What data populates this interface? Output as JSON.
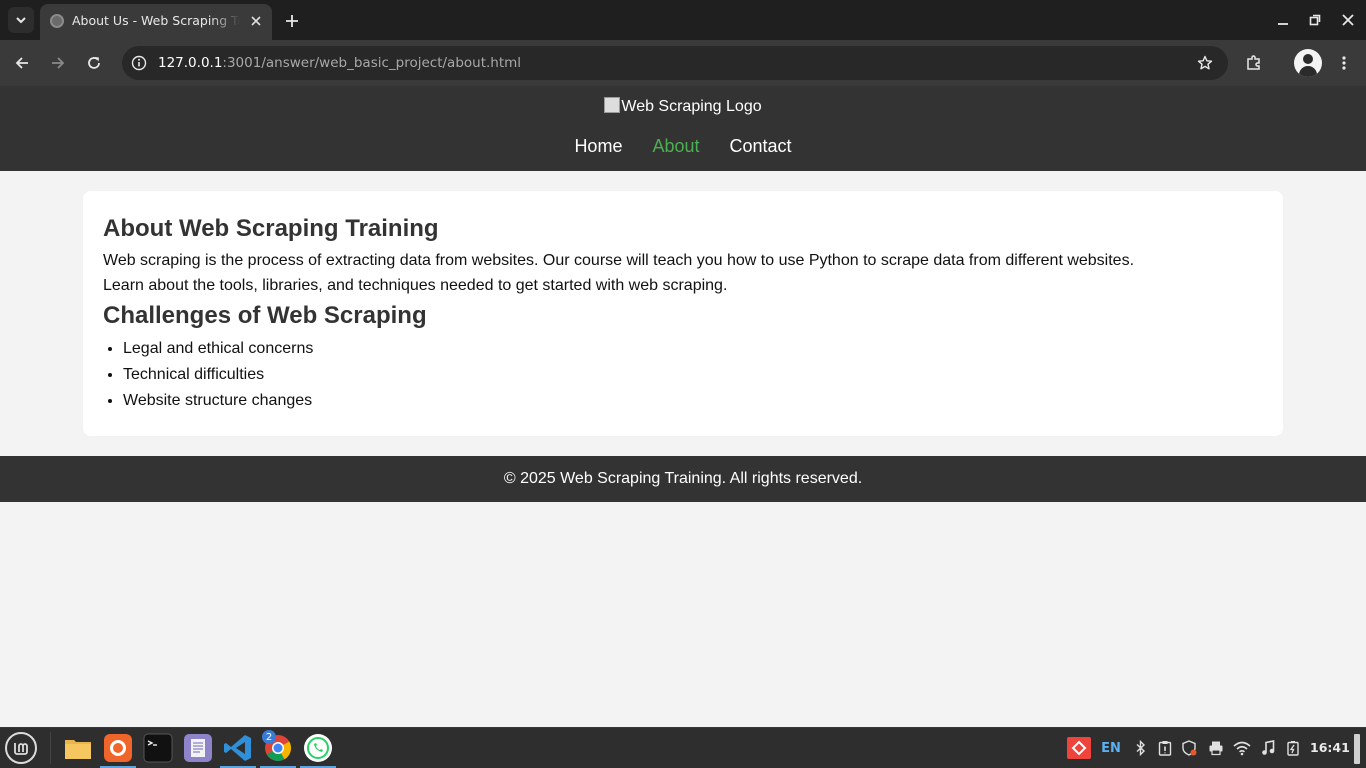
{
  "browser": {
    "tab_title": "About Us - Web Scraping Training",
    "url_host": "127.0.0.1",
    "url_rest": ":3001/answer/web_basic_project/about.html"
  },
  "page": {
    "logo_alt": "Web Scraping Logo",
    "nav": [
      {
        "label": "Home",
        "active": false
      },
      {
        "label": "About",
        "active": true
      },
      {
        "label": "Contact",
        "active": false
      }
    ],
    "heading": "About Web Scraping Training",
    "paragraphs": [
      "Web scraping is the process of extracting data from websites. Our course will teach you how to use Python to scrape data from different websites.",
      "Learn about the tools, libraries, and techniques needed to get started with web scraping."
    ],
    "challenges_heading": "Challenges of Web Scraping",
    "challenges": [
      "Legal and ethical concerns",
      "Technical difficulties",
      "Website structure changes"
    ],
    "footer": "© 2025 Web Scraping Training. All rights reserved.",
    "colors": {
      "header_bg": "#333333",
      "active_link": "#4caf50",
      "page_bg": "#f3f3f3"
    }
  },
  "taskbar": {
    "apps": [
      "files-icon",
      "firefox-icon",
      "terminal-icon",
      "text-editor-icon",
      "vscode-icon",
      "chrome-icon",
      "whatsapp-icon"
    ],
    "chrome_badge": "2",
    "language": "EN",
    "clock": "16:41"
  }
}
